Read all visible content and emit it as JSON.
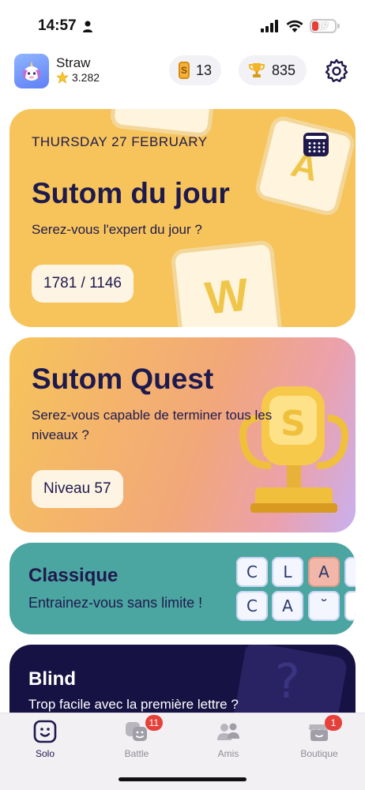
{
  "status_bar": {
    "time": "14:57",
    "battery": "17"
  },
  "header": {
    "username": "Straw",
    "stars": "3.282",
    "coins": "13",
    "coin_symbol": "S",
    "trophies": "835"
  },
  "daily": {
    "date": "THURSDAY 27 FEBRUARY",
    "title": "Sutom du jour",
    "subtitle": "Serez-vous l'expert du jour ?",
    "progress": "1781 / 1146",
    "tile_letters": [
      "A",
      "W"
    ]
  },
  "quest": {
    "title": "Sutom Quest",
    "subtitle": "Serez-vous capable de terminer tous les niveaux ?",
    "level": "Niveau 57",
    "trophy_letter": "S"
  },
  "classic": {
    "title": "Classique",
    "subtitle": "Entrainez-vous sans limite !",
    "letters_row1": [
      "C",
      "L",
      "A"
    ],
    "letters_row2": [
      "C",
      "A",
      "˘"
    ]
  },
  "blind": {
    "title": "Blind",
    "subtitle": "Trop facile avec la première lettre ?",
    "symbol": "?"
  },
  "tabs": [
    {
      "label": "Solo",
      "badge": ""
    },
    {
      "label": "Battle",
      "badge": "11"
    },
    {
      "label": "Amis",
      "badge": ""
    },
    {
      "label": "Boutique",
      "badge": "1"
    }
  ],
  "colors": {
    "daily_bg": "#f6c45a",
    "classic_bg": "#4ba5a0",
    "blind_bg": "#171244",
    "text_dark": "#1f1a4d",
    "notif": "#e5403a"
  }
}
